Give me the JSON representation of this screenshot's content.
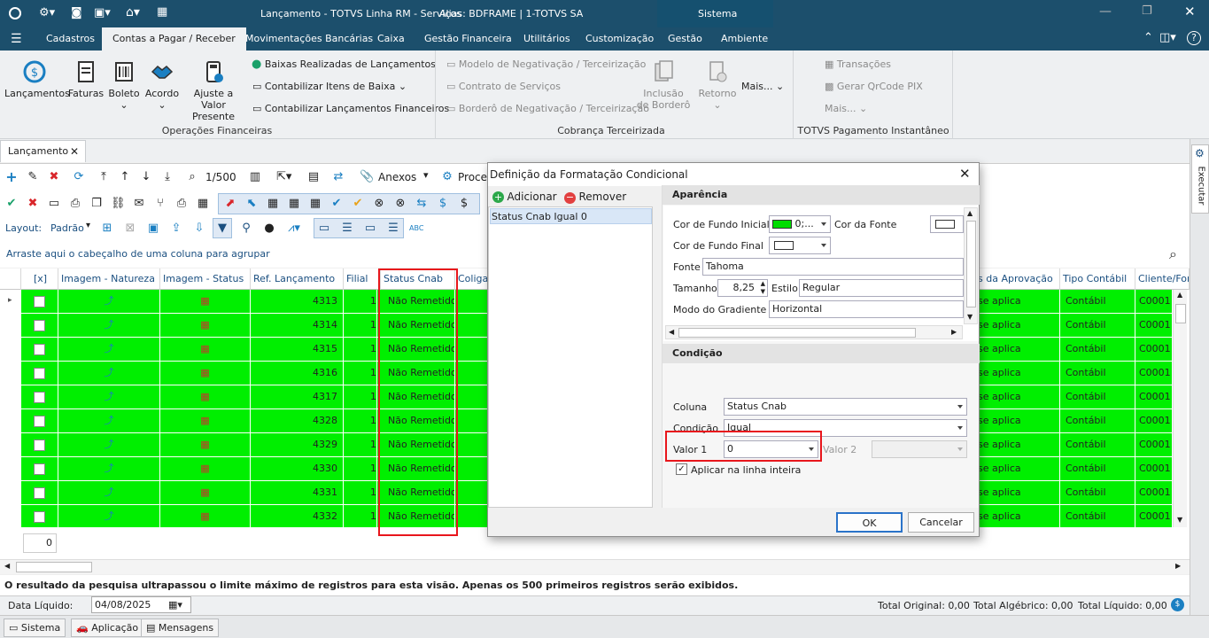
{
  "title": {
    "app": "Lançamento - TOTVS Linha RM - Serviços",
    "alias": "Alias: BDFRAME | 1-TOTVS SA",
    "system_label": "Sistema"
  },
  "menu": {
    "items": [
      "Cadastros",
      "Contas a Pagar / Receber",
      "Movimentações Bancárias",
      "Caixa",
      "Gestão Financeira",
      "Utilitários",
      "Customização",
      "Gestão",
      "Ambiente"
    ]
  },
  "ribbon": {
    "big_buttons": [
      "Lançamentos",
      "Faturas",
      "Boleto",
      "Acordo",
      "Ajuste a Valor\nPresente"
    ],
    "small_items": [
      "Baixas Realizadas de Lançamentos",
      "Contabilizar Itens de Baixa",
      "Contabilizar Lançamentos Financeiros"
    ],
    "group1_label": "Operações Financeiras",
    "cobranca_items": [
      "Modelo de Negativação / Terceirização",
      "Contrato de Serviços",
      "Borderô de Negativação / Terceirização"
    ],
    "cobranca_buttons": [
      "Inclusão\nde Borderô",
      "Retorno",
      "Mais..."
    ],
    "group2_label": "Cobrança Terceirizada",
    "pix_items": [
      "Transações",
      "Gerar QrCode PIX",
      "Mais..."
    ],
    "group3_label": "TOTVS Pagamento Instantâneo"
  },
  "doc_tab": {
    "label": "Lançamento"
  },
  "toolbar": {
    "page_indicator": "1/500",
    "anexos": "Anexos",
    "process": "Proce",
    "layout_label": "Layout:",
    "layout_value": "Padrão"
  },
  "group_hint": "Arraste aqui o cabeçalho de uma coluna para agrupar",
  "grid": {
    "headers": [
      "[x]",
      "Imagem - Natureza",
      "Imagem - Status",
      "Ref. Lançamento",
      "Filial",
      "Status Cnab",
      "Coligad",
      "s da Aprovação",
      "Tipo Contábil",
      "Cliente/For"
    ],
    "rows": [
      {
        "ref": "4313",
        "filial": "1",
        "status": "Não Remetido",
        "aprov": "se aplica",
        "tipo": "Contábil",
        "cliente": "C0001"
      },
      {
        "ref": "4314",
        "filial": "1",
        "status": "Não Remetido",
        "aprov": "se aplica",
        "tipo": "Contábil",
        "cliente": "C0001"
      },
      {
        "ref": "4315",
        "filial": "1",
        "status": "Não Remetido",
        "aprov": "se aplica",
        "tipo": "Contábil",
        "cliente": "C0001"
      },
      {
        "ref": "4316",
        "filial": "1",
        "status": "Não Remetido",
        "aprov": "se aplica",
        "tipo": "Contábil",
        "cliente": "C0001"
      },
      {
        "ref": "4317",
        "filial": "1",
        "status": "Não Remetido",
        "aprov": "se aplica",
        "tipo": "Contábil",
        "cliente": "C0001"
      },
      {
        "ref": "4328",
        "filial": "1",
        "status": "Não Remetido",
        "aprov": "se aplica",
        "tipo": "Contábil",
        "cliente": "C0001"
      },
      {
        "ref": "4329",
        "filial": "1",
        "status": "Não Remetido",
        "aprov": "se aplica",
        "tipo": "Contábil",
        "cliente": "C0001"
      },
      {
        "ref": "4330",
        "filial": "1",
        "status": "Não Remetido",
        "aprov": "se aplica",
        "tipo": "Contábil",
        "cliente": "C0001"
      },
      {
        "ref": "4331",
        "filial": "1",
        "status": "Não Remetido",
        "aprov": "se aplica",
        "tipo": "Contábil",
        "cliente": "C0001"
      },
      {
        "ref": "4332",
        "filial": "1",
        "status": "Não Remetido",
        "aprov": "se aplica",
        "tipo": "Contábil",
        "cliente": "C0001"
      }
    ],
    "footer_count": "0",
    "row_color": "#00ef00"
  },
  "warning": "O resultado da pesquisa ultrapassou o limite máximo de registros para esta visão. Apenas os 500 primeiros registros serão exibidos.",
  "status": {
    "data_label": "Data Líquido:",
    "data_value": "04/08/2025",
    "total_original": "Total Original: 0,00",
    "total_algebrico": "Total Algébrico: 0,00",
    "total_liquido": "Total Líquido: 0,00"
  },
  "bottom_tabs": [
    "Sistema",
    "Aplicação",
    "Mensagens"
  ],
  "right_panel": "Executar",
  "dialog": {
    "title": "Definição da Formatação Condicional",
    "add": "Adicionar",
    "remove": "Remover",
    "rule": "Status Cnab Igual 0",
    "aparencia": "Aparência",
    "cor_fundo_inicial_label": "Cor de Fundo Inicial",
    "cor_fundo_inicial_value": "0;...",
    "cor_fonte_label": "Cor da Fonte",
    "cor_fundo_final_label": "Cor de Fundo Final",
    "fonte_label": "Fonte",
    "fonte_value": "Tahoma",
    "tamanho_label": "Tamanho",
    "tamanho_value": "8,25",
    "estilo_label": "Estilo",
    "estilo_value": "Regular",
    "gradiente_label": "Modo do Gradiente",
    "gradiente_value": "Horizontal",
    "condicao_header": "Condição",
    "coluna_label": "Coluna",
    "coluna_value": "Status Cnab",
    "condicao_label": "Condição",
    "condicao_value": "Igual",
    "valor1_label": "Valor 1",
    "valor1_value": "0",
    "valor2_label": "Valor 2",
    "aplicar_label": "Aplicar na linha inteira",
    "ok": "OK",
    "cancel": "Cancelar",
    "green_color": "#00dd00"
  }
}
